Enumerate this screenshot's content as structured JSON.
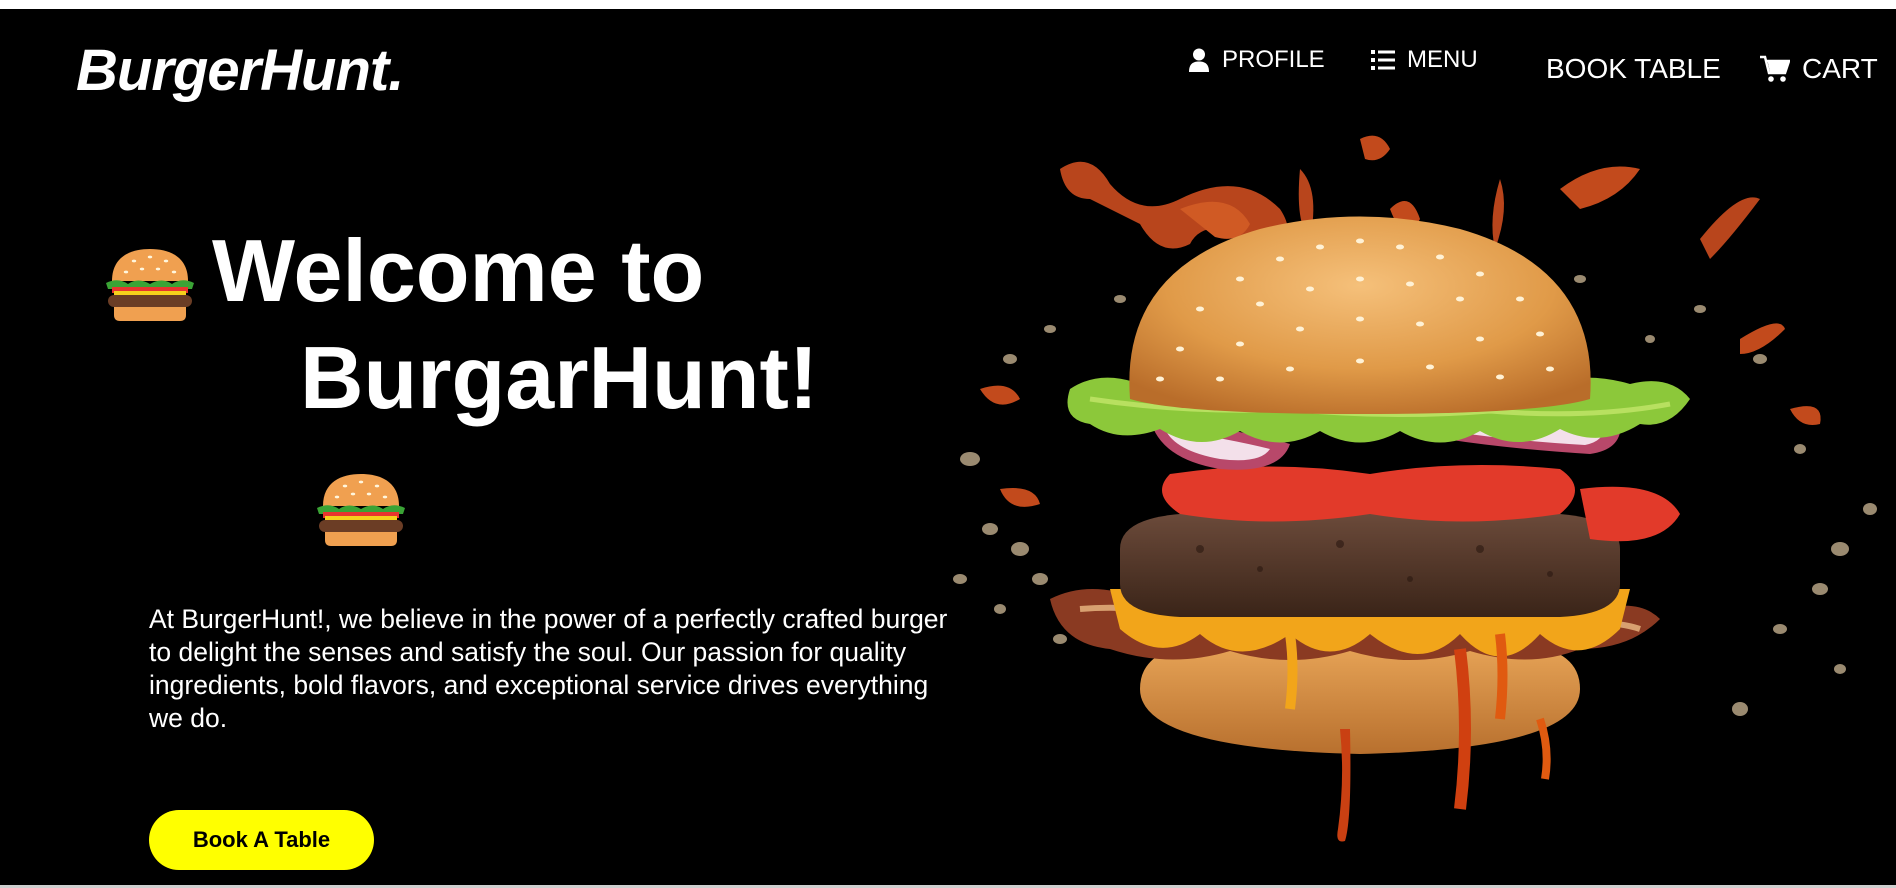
{
  "brand": {
    "logo": "BurgerHunt."
  },
  "nav": {
    "profile": {
      "label": "PROFILE",
      "icon": "user-icon"
    },
    "menu": {
      "label": "MENU",
      "icon": "list-icon"
    },
    "book_table": {
      "label": "BOOK TABLE"
    },
    "cart": {
      "label": "CART",
      "icon": "cart-icon"
    }
  },
  "hero": {
    "headline_line1": "Welcome to",
    "headline_line2": "BurgarHunt!",
    "emoji": "burger-emoji",
    "description": "At BurgerHunt!, we believe in the power of a perfectly crafted burger to delight the senses and satisfy the soul. Our passion for quality ingredients, bold flavors, and exceptional service drives everything we do.",
    "cta_label": "Book A Table",
    "image": "exploding-burger-photo"
  },
  "colors": {
    "background": "#000000",
    "text": "#ffffff",
    "accent": "#ffff00"
  }
}
